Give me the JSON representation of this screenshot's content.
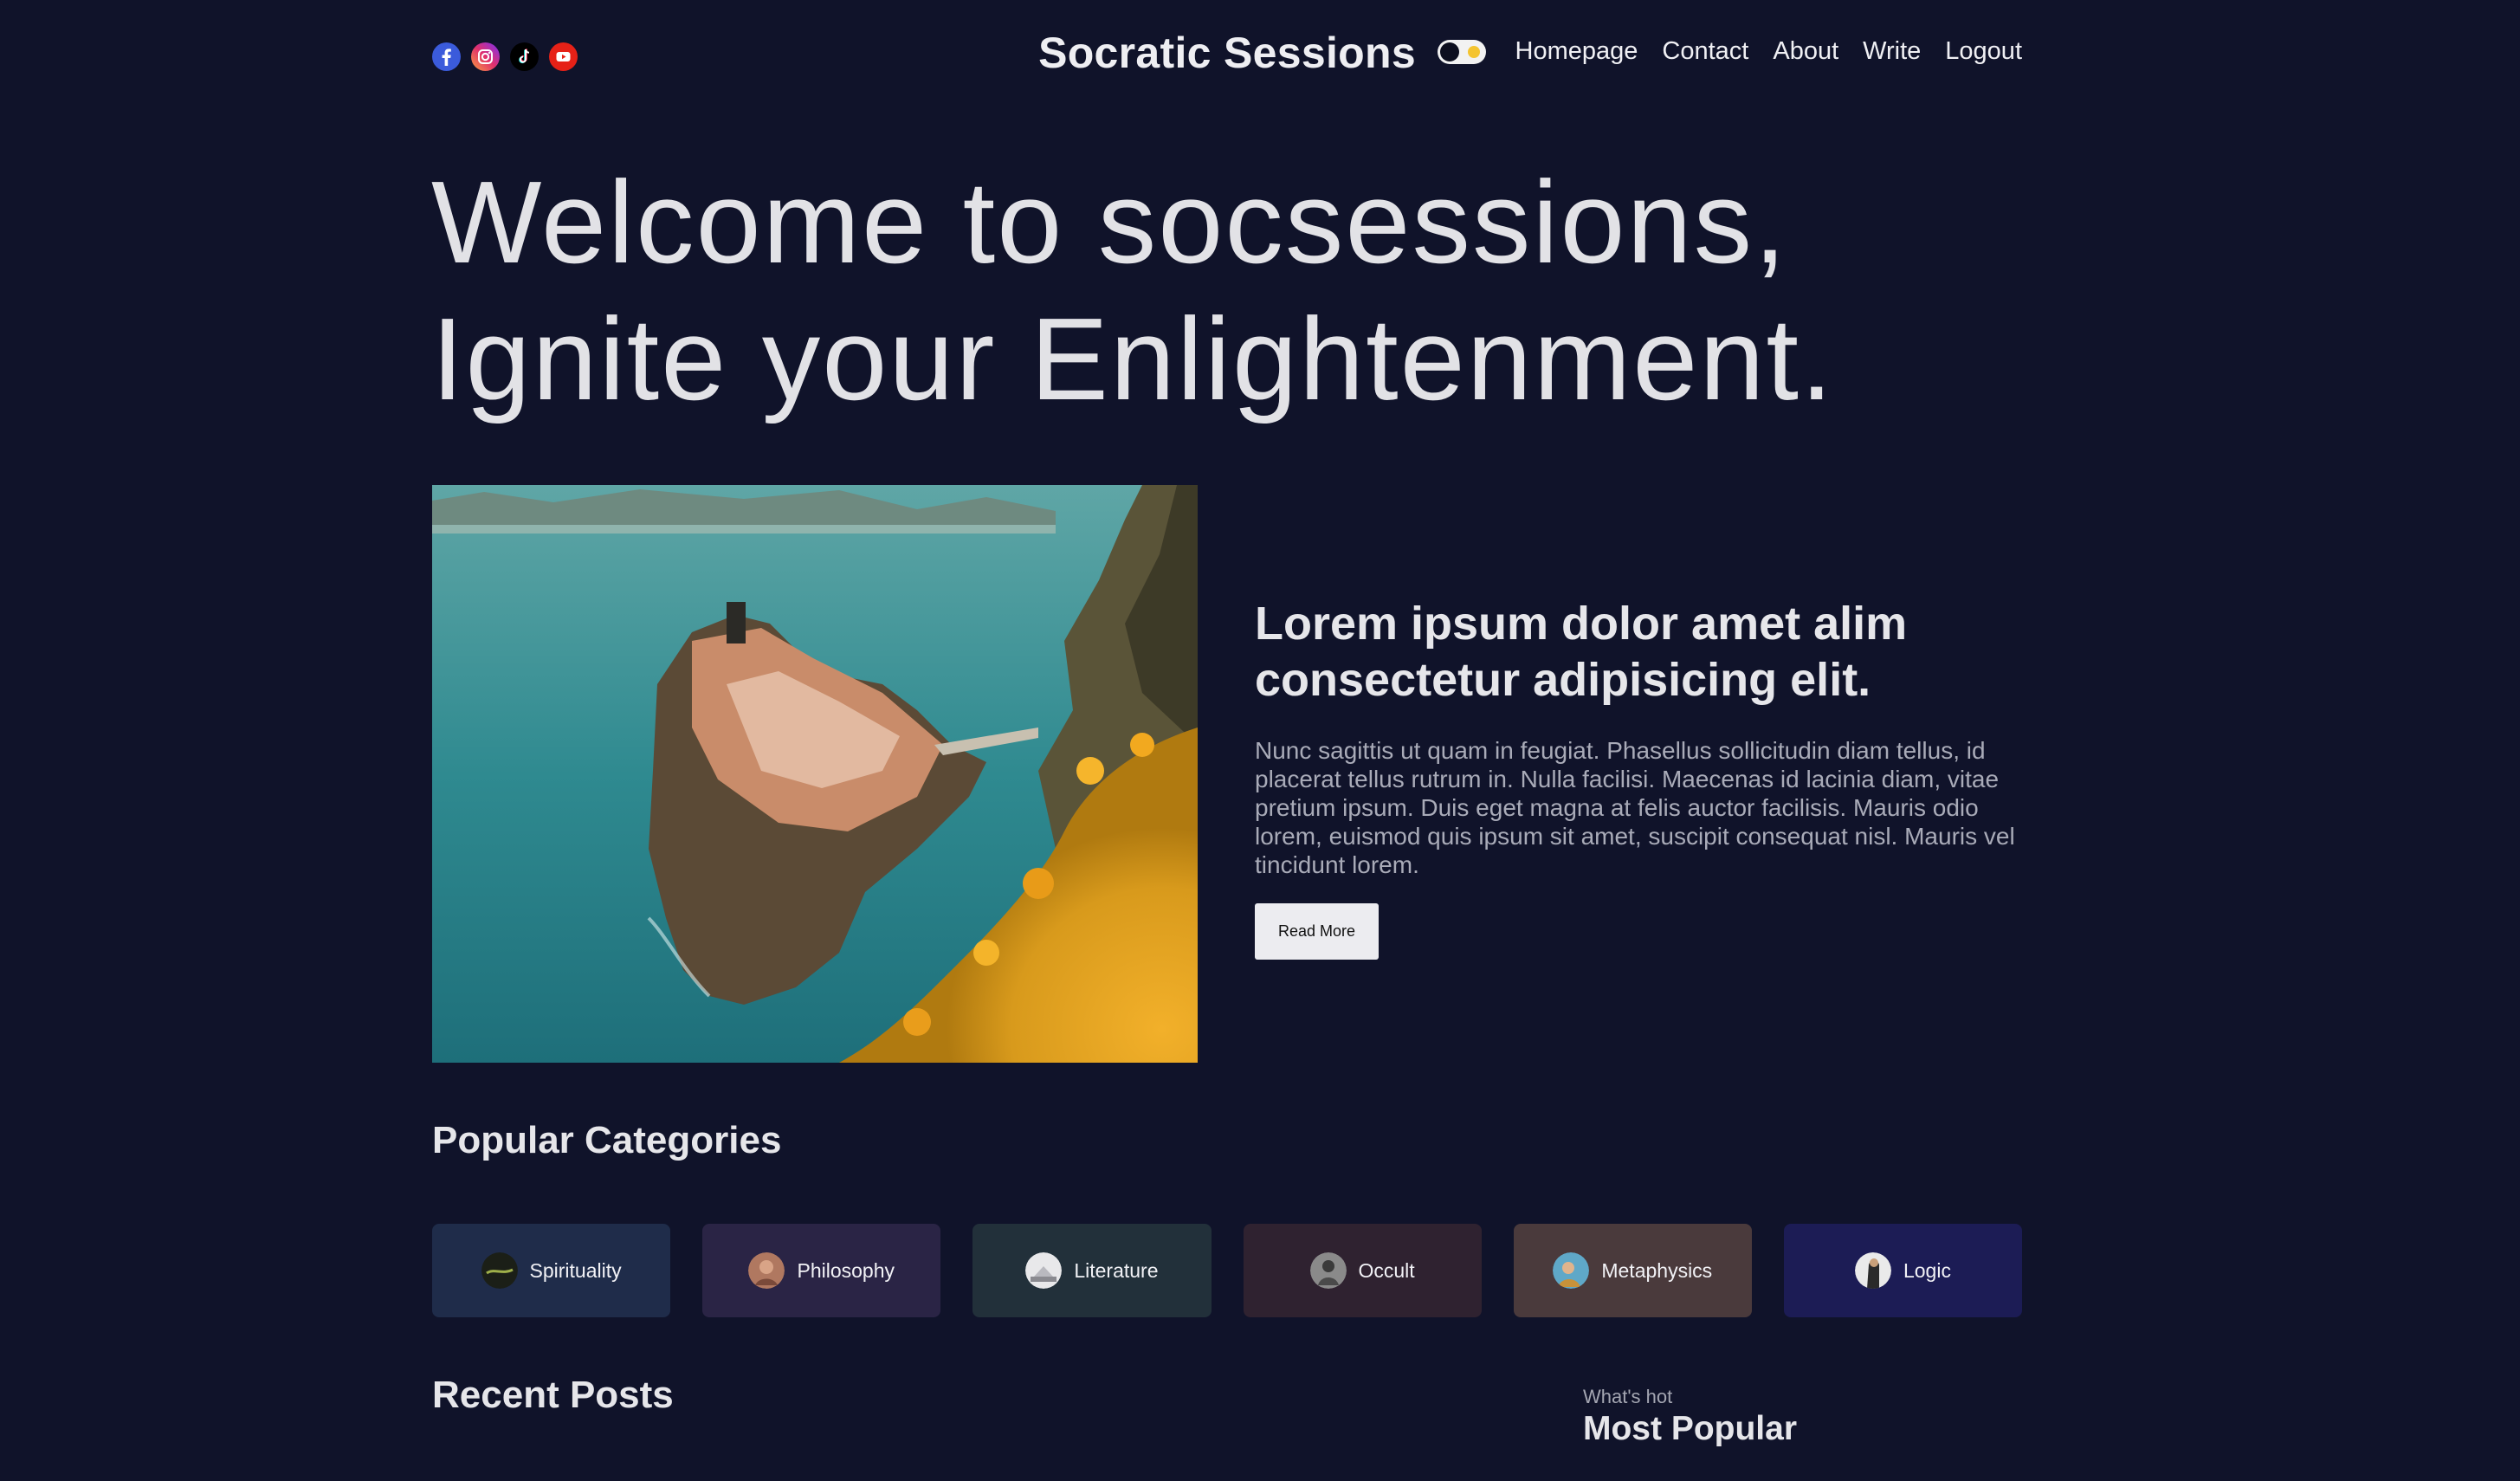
{
  "nav": {
    "socials": [
      {
        "icon": "facebook-icon",
        "color": "#3b5bdb"
      },
      {
        "icon": "instagram-icon",
        "color": "#d6249f"
      },
      {
        "icon": "tiktok-icon",
        "color": "#000000"
      },
      {
        "icon": "youtube-icon",
        "color": "#e62117"
      }
    ],
    "brand": "Socratic Sessions",
    "links": [
      "Homepage",
      "Contact",
      "About",
      "Write",
      "Logout"
    ]
  },
  "hero": {
    "line1": "Welcome to socsessions,",
    "line2": "Ignite your Enlightenment."
  },
  "featured": {
    "title": "Lorem ipsum dolor amet alim consectetur adipisicing elit.",
    "description": "Nunc sagittis ut quam in feugiat. Phasellus sollicitudin diam tellus, id placerat tellus rutrum in. Nulla facilisi. Maecenas id lacinia diam, vitae pretium ipsum. Duis eget magna at felis auctor facilisis. Mauris odio lorem, euismod quis ipsum sit amet, suscipit consequat nisl. Mauris vel tincidunt lorem.",
    "button": "Read More"
  },
  "categories": {
    "title": "Popular Categories",
    "items": [
      {
        "label": "Spirituality",
        "bg": "#1f2c4a"
      },
      {
        "label": "Philosophy",
        "bg": "#2a2445"
      },
      {
        "label": "Literature",
        "bg": "#22303a"
      },
      {
        "label": "Occult",
        "bg": "#2f2230"
      },
      {
        "label": "Metaphysics",
        "bg": "#4a3a3c"
      },
      {
        "label": "Logic",
        "bg": "#1c1c55"
      }
    ]
  },
  "recent": {
    "title": "Recent Posts"
  },
  "sidebar": {
    "subtitle": "What's hot",
    "title": "Most Popular"
  },
  "theme": {
    "background": "#10132a",
    "toggle_sun": "#f4c430"
  }
}
